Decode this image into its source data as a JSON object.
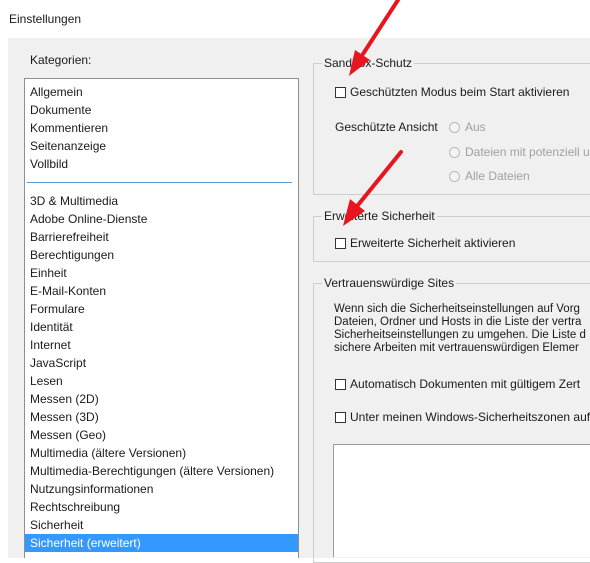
{
  "window": {
    "title": "Einstellungen"
  },
  "categories": {
    "label": "Kategorien:",
    "top_items": [
      "Allgemein",
      "Dokumente",
      "Kommentieren",
      "Seitenanzeige",
      "Vollbild"
    ],
    "items": [
      "3D & Multimedia",
      "Adobe Online-Dienste",
      "Barrierefreiheit",
      "Berechtigungen",
      "Einheit",
      "E-Mail-Konten",
      "Formulare",
      "Identität",
      "Internet",
      "JavaScript",
      "Lesen",
      "Messen (2D)",
      "Messen (3D)",
      "Messen (Geo)",
      "Multimedia (ältere Versionen)",
      "Multimedia-Berechtigungen (ältere Versionen)",
      "Nutzungsinformationen",
      "Rechtschreibung",
      "Sicherheit",
      "Sicherheit (erweitert)"
    ],
    "selected": "Sicherheit (erweitert)"
  },
  "sandbox": {
    "title": "Sandbox-Schutz",
    "checkbox_label": "Geschützten Modus beim Start aktivieren",
    "protected_view_label": "Geschützte Ansicht",
    "radio_options": [
      "Aus",
      "Dateien mit potenziell u",
      "Alle Dateien"
    ]
  },
  "enhanced": {
    "title": "Erweiterte Sicherheit",
    "checkbox_label": "Erweiterte Sicherheit aktivieren"
  },
  "trusted": {
    "title": "Vertrauenswürdige Sites",
    "description": [
      "Wenn sich die Sicherheitseinstellungen auf Vorg",
      "Dateien, Ordner und Hosts in die Liste der vertra",
      "Sicherheitseinstellungen zu umgehen. Die Liste d",
      "sichere Arbeiten mit vertrauenswürdigen Elemer"
    ],
    "checkbox_auto": "Automatisch Dokumenten mit gültigem Zert",
    "checkbox_windows": "Unter meinen Windows-Sicherheitszonen auf"
  },
  "colors": {
    "selection": "#3399ff",
    "annotation_arrow": "#e8141e"
  }
}
